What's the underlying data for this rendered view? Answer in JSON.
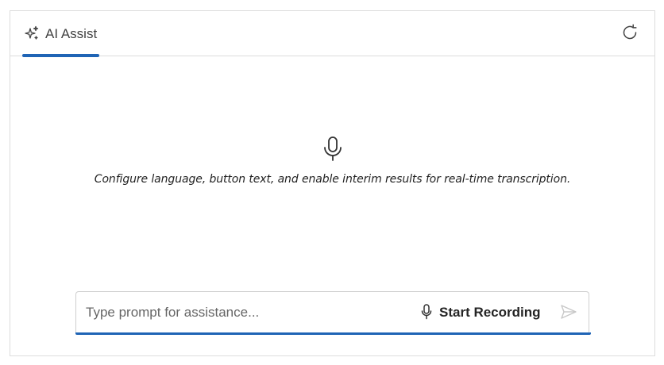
{
  "header": {
    "tab_label": "AI Assist",
    "tab_icon": "sparkle-icon",
    "refresh_icon": "refresh-icon"
  },
  "empty_state": {
    "icon": "microphone-icon",
    "hint": "Configure language, button text, and enable interim results for real-time transcription."
  },
  "input": {
    "placeholder": "Type prompt for assistance...",
    "value": "",
    "record_label": "Start Recording",
    "record_icon": "microphone-icon",
    "send_icon": "send-icon"
  },
  "colors": {
    "accent": "#1f64b5",
    "border": "#dcdcdc",
    "disabled_icon": "#c8c8c8"
  }
}
